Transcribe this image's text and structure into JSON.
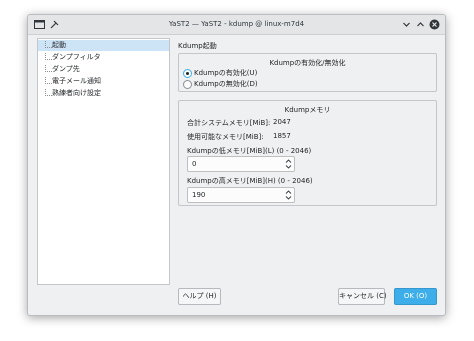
{
  "window": {
    "title": "YaST2 — YaST2 - kdump @ linux-m7d4"
  },
  "sidebar": {
    "items": [
      {
        "label": "起動",
        "selected": true
      },
      {
        "label": "ダンプフィルタ",
        "selected": false
      },
      {
        "label": "ダンプ先",
        "selected": false
      },
      {
        "label": "電子メール通知",
        "selected": false
      },
      {
        "label": "熟練者向け設定",
        "selected": false
      }
    ]
  },
  "main": {
    "section_title": "Kdump起動",
    "enable_group": {
      "title": "Kdumpの有効化/無効化",
      "options": [
        {
          "label": "Kdumpの有効化(U)",
          "checked": true
        },
        {
          "label": "Kdumpの無効化(D)",
          "checked": false
        }
      ]
    },
    "memory_group": {
      "title": "Kdumpメモリ",
      "total_label": "合計システムメモリ[MiB]:",
      "total_value": "2047",
      "usable_label": "使用可能なメモリ[MiB]:",
      "usable_value": "1857",
      "low_label": "Kdumpの低メモリ[MiB](L) (0 - 2046)",
      "low_value": "0",
      "high_label": "Kdumpの高メモリ[MiB](H) (0 - 2046)",
      "high_value": "190"
    }
  },
  "buttons": {
    "help": "ヘルプ (H)",
    "cancel": "キャンセル (C)",
    "ok": "OK (O)"
  },
  "colors": {
    "accent": "#3daee9",
    "selection": "#cde4f7",
    "window_bg": "#eff0f1"
  }
}
